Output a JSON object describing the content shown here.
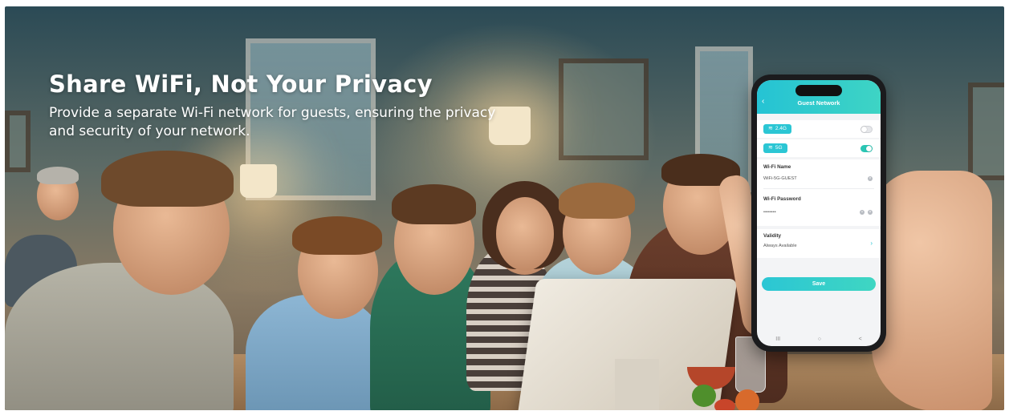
{
  "banner": {
    "headline": "Share WiFi, Not Your Privacy",
    "subline": "Provide a separate Wi-Fi network for guests, ensuring the privacy and security of your network."
  },
  "phone": {
    "header": {
      "title": "Guest Network",
      "back_icon": "chevron-left-icon"
    },
    "bands": [
      {
        "label": "2.4G",
        "enabled": false
      },
      {
        "label": "5G",
        "enabled": true
      }
    ],
    "wifi_name": {
      "label": "Wi-Fi Name",
      "value": "WiFi-5G-GUEST"
    },
    "wifi_password": {
      "label": "Wi-Fi Password",
      "value": "••••••••"
    },
    "validity": {
      "label": "Validity",
      "value": "Always Available"
    },
    "save_label": "Save",
    "nav": {
      "recent": "III",
      "home": "○",
      "back": "<"
    },
    "colors": {
      "accent": "#2bc6d4",
      "toggle_on": "#2bc6b4"
    }
  }
}
